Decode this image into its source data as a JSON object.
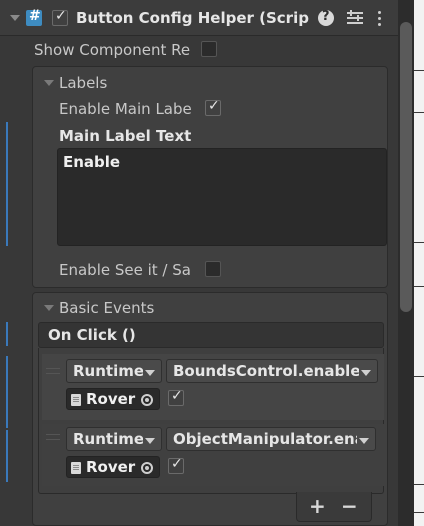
{
  "component": {
    "title": "Button Config Helper (Scrip",
    "enabled": true,
    "header_icons": {
      "foldout": "foldout-arrow-icon",
      "script": "script-icon",
      "help": "help-icon",
      "preset": "preset-icon",
      "menu": "kebab-menu-icon"
    }
  },
  "fields": {
    "show_component_label": "Show Component Re",
    "show_component_checked": false
  },
  "labels_section": {
    "title": "Labels",
    "enable_main_label": "Enable Main Labe",
    "enable_main_checked": true,
    "main_label_text_label": "Main Label Text",
    "main_label_text_value": "Enable",
    "enable_see_it_label": "Enable See it / Sa",
    "enable_see_it_checked": false
  },
  "basic_events": {
    "title": "Basic Events",
    "event_name": "On Click ()",
    "entries": [
      {
        "runtime": "Runtime",
        "function": "BoundsControl.enable‹",
        "object": "Rover",
        "checked": true
      },
      {
        "runtime": "Runtime",
        "function": "ObjectManipulator.ena",
        "object": "Rover",
        "checked": true
      }
    ],
    "add_label": "+",
    "remove_label": "−"
  },
  "colors": {
    "panel": "#383838",
    "section": "#404040",
    "accent_blue": "#3a79bb",
    "text": "#c8c8c8"
  }
}
